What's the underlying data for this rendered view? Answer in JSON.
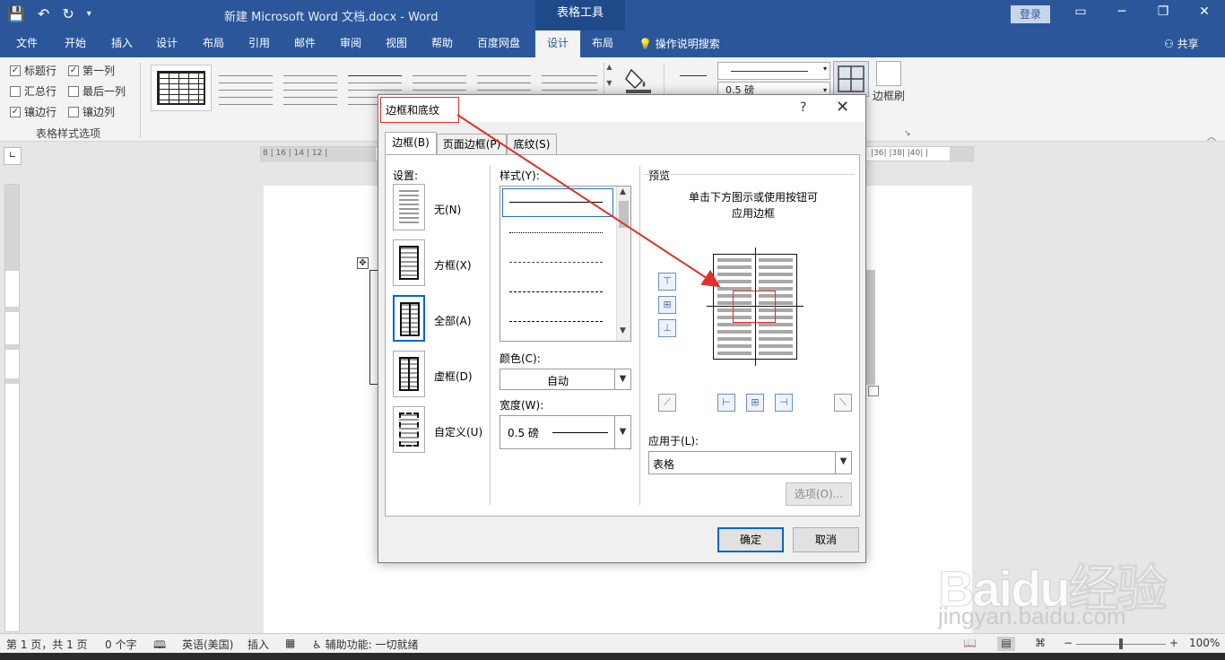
{
  "window": {
    "doc_title": "新建 Microsoft Word 文档.docx  -  Word",
    "contextual_group": "表格工具",
    "login": "登录",
    "share": "共享",
    "tell_me": "操作说明搜索"
  },
  "ribbon_tabs": [
    "文件",
    "开始",
    "插入",
    "设计",
    "布局",
    "引用",
    "邮件",
    "审阅",
    "视图",
    "帮助",
    "百度网盘",
    "设计",
    "布局"
  ],
  "ribbon": {
    "checkboxes": [
      {
        "label": "标题行",
        "checked": "✓"
      },
      {
        "label": "第一列",
        "checked": "✓"
      },
      {
        "label": "汇总行",
        "checked": ""
      },
      {
        "label": "最后一列",
        "checked": ""
      },
      {
        "label": "镶边行",
        "checked": "✓"
      },
      {
        "label": "镶边列",
        "checked": ""
      }
    ],
    "group_label": "表格样式选项",
    "pen_weight": "0.5 磅",
    "border_painter": "边框刷"
  },
  "ruler": {
    "h_left": "8 | 16 | 14 | 12 |",
    "h_right": "|36| |38| |40| |"
  },
  "dialog": {
    "title": "边框和底纹",
    "help": "?",
    "close": "✕",
    "tabs": [
      "边框(B)",
      "页面边框(P)",
      "底纹(S)"
    ],
    "setting_label": "设置:",
    "settings": [
      "无(N)",
      "方框(X)",
      "全部(A)",
      "虚框(D)",
      "自定义(U)"
    ],
    "style_label": "样式(Y):",
    "color_label": "颜色(C):",
    "color_value": "自动",
    "width_label": "宽度(W):",
    "width_value": "0.5 磅",
    "preview_label": "预览",
    "preview_hint_1": "单击下方图示或使用按钮可",
    "preview_hint_2": "应用边框",
    "apply_label": "应用于(L):",
    "apply_value": "表格",
    "options": "选项(O)...",
    "ok": "确定",
    "cancel": "取消"
  },
  "status": {
    "page": "第 1 页，共 1 页",
    "words": "0 个字",
    "lang": "英语(美国)",
    "insert": "插入",
    "accessibility": "辅助功能: 一切就绪",
    "zoom": "100%"
  },
  "watermark": {
    "brand": "Baidu经验",
    "url": "jingyan.baidu.com"
  },
  "colors": {
    "accent": "#2b579a",
    "annotation": "#e0302a"
  }
}
